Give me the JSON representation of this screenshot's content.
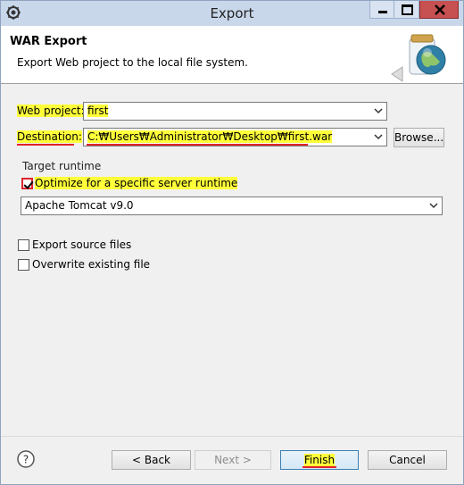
{
  "window": {
    "title": "Export"
  },
  "banner": {
    "title": "WAR Export",
    "description": "Export Web project to the local file system.",
    "icon": "war-export-globe-icon"
  },
  "form": {
    "web_project_label": "Web project:",
    "web_project_value": "first",
    "destination_label": "Destination:",
    "destination_value": "C:₩Users₩Administrator₩Desktop₩first.war",
    "browse_label": "Browse...",
    "target_runtime_label": "Target runtime",
    "optimize_label": "Optimize for a specific server runtime",
    "optimize_checked": true,
    "runtime_value": "Apache Tomcat v9.0",
    "export_source_label": "Export source files",
    "export_source_checked": false,
    "overwrite_label": "Overwrite existing file",
    "overwrite_checked": false
  },
  "footer": {
    "back_label": "< Back",
    "next_label": "Next >",
    "finish_label": "Finish",
    "cancel_label": "Cancel"
  },
  "colors": {
    "highlight": "#ffff3a",
    "annotation_red": "#e0232b",
    "titlebar": "#c9d7eb",
    "close_button": "#c75050"
  }
}
